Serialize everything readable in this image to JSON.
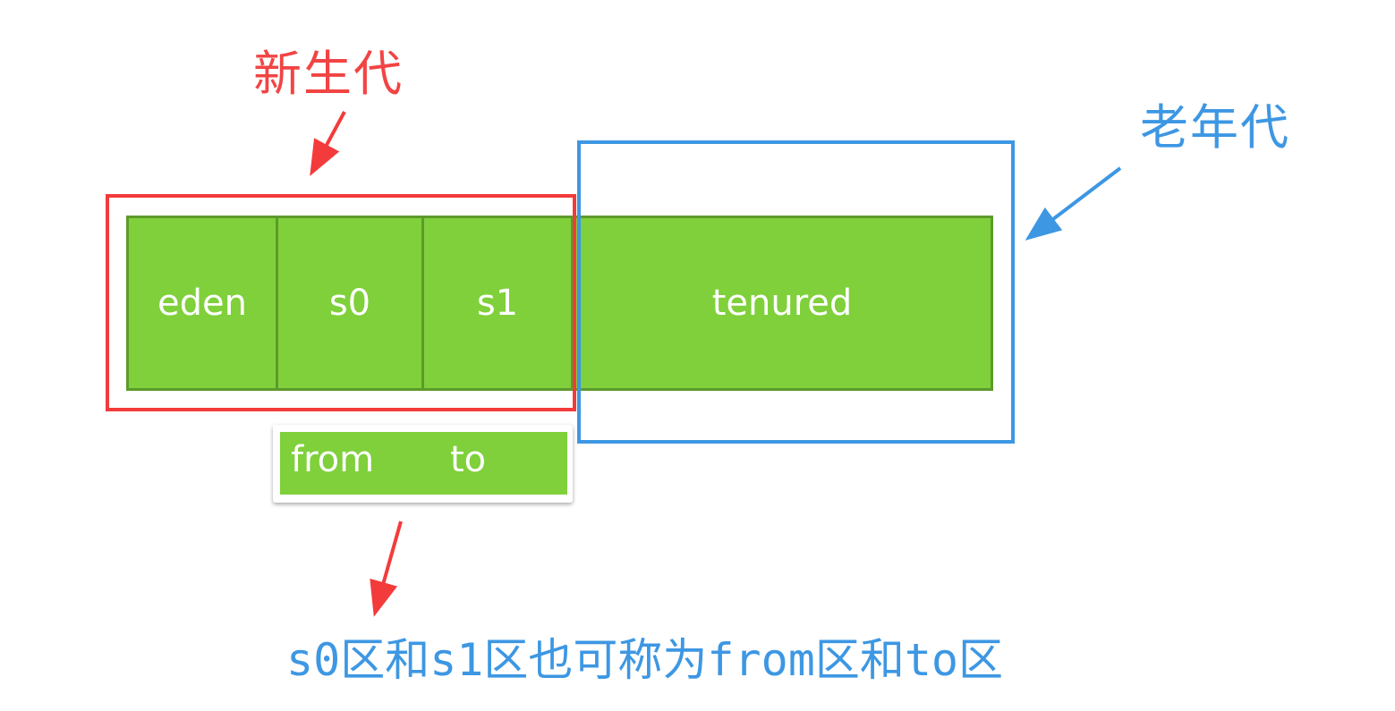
{
  "labels": {
    "young_generation": "新生代",
    "old_generation": "老年代"
  },
  "regions": [
    "eden",
    "s0",
    "s1",
    "tenured"
  ],
  "survivor_alias": {
    "from": "from",
    "to": "to"
  },
  "caption": "s0区和s1区也可称为from区和to区",
  "colors": {
    "young": "#f33b3b",
    "old": "#3d97e3",
    "region_fill": "#7fd03b",
    "region_border": "#5d9a2c"
  }
}
